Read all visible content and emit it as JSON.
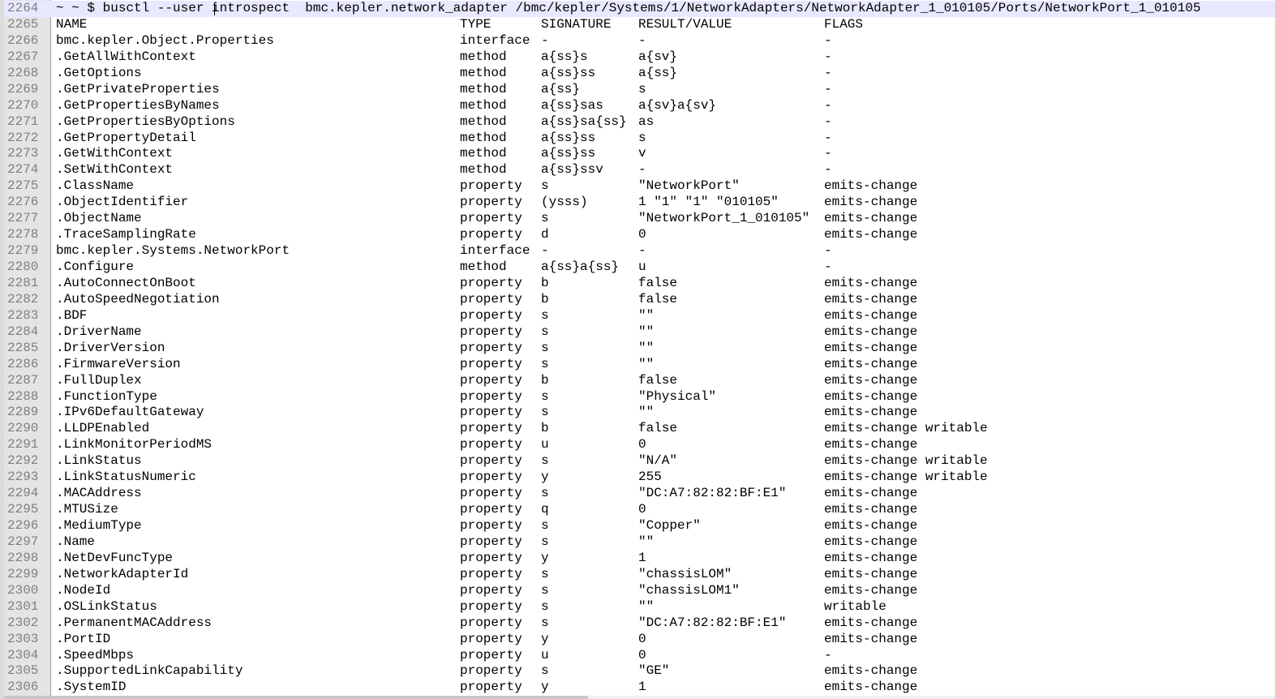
{
  "command": {
    "line_number": "2264",
    "text": "~ ~ $ busctl --user introspect  bmc.kepler.network_adapter /bmc/kepler/Systems/1/NetworkAdapters/NetworkAdapter_1_010105/Ports/NetworkPort_1_010105"
  },
  "header": {
    "line_number": "2265",
    "name": "NAME",
    "type": "TYPE",
    "signature": "SIGNATURE",
    "value": "RESULT/VALUE",
    "flags": "FLAGS"
  },
  "rows": [
    {
      "ln": "2266",
      "name": "bmc.kepler.Object.Properties",
      "type": "interface",
      "sig": "-",
      "val": "-",
      "flags": "-"
    },
    {
      "ln": "2267",
      "name": ".GetAllWithContext",
      "type": "method",
      "sig": "a{ss}s",
      "val": "a{sv}",
      "flags": "-"
    },
    {
      "ln": "2268",
      "name": ".GetOptions",
      "type": "method",
      "sig": "a{ss}ss",
      "val": "a{ss}",
      "flags": "-"
    },
    {
      "ln": "2269",
      "name": ".GetPrivateProperties",
      "type": "method",
      "sig": "a{ss}",
      "val": "s",
      "flags": "-"
    },
    {
      "ln": "2270",
      "name": ".GetPropertiesByNames",
      "type": "method",
      "sig": "a{ss}sas",
      "val": "a{sv}a{sv}",
      "flags": "-"
    },
    {
      "ln": "2271",
      "name": ".GetPropertiesByOptions",
      "type": "method",
      "sig": "a{ss}sa{ss}",
      "val": "as",
      "flags": "-"
    },
    {
      "ln": "2272",
      "name": ".GetPropertyDetail",
      "type": "method",
      "sig": "a{ss}ss",
      "val": "s",
      "flags": "-"
    },
    {
      "ln": "2273",
      "name": ".GetWithContext",
      "type": "method",
      "sig": "a{ss}ss",
      "val": "v",
      "flags": "-"
    },
    {
      "ln": "2274",
      "name": ".SetWithContext",
      "type": "method",
      "sig": "a{ss}ssv",
      "val": "-",
      "flags": "-"
    },
    {
      "ln": "2275",
      "name": ".ClassName",
      "type": "property",
      "sig": "s",
      "val": "\"NetworkPort\"",
      "flags": "emits-change"
    },
    {
      "ln": "2276",
      "name": ".ObjectIdentifier",
      "type": "property",
      "sig": "(ysss)",
      "val": "1 \"1\" \"1\" \"010105\"",
      "flags": "emits-change"
    },
    {
      "ln": "2277",
      "name": ".ObjectName",
      "type": "property",
      "sig": "s",
      "val": "\"NetworkPort_1_010105\"",
      "flags": "emits-change"
    },
    {
      "ln": "2278",
      "name": ".TraceSamplingRate",
      "type": "property",
      "sig": "d",
      "val": "0",
      "flags": "emits-change"
    },
    {
      "ln": "2279",
      "name": "bmc.kepler.Systems.NetworkPort",
      "type": "interface",
      "sig": "-",
      "val": "-",
      "flags": "-"
    },
    {
      "ln": "2280",
      "name": ".Configure",
      "type": "method",
      "sig": "a{ss}a{ss}",
      "val": "u",
      "flags": "-"
    },
    {
      "ln": "2281",
      "name": ".AutoConnectOnBoot",
      "type": "property",
      "sig": "b",
      "val": "false",
      "flags": "emits-change"
    },
    {
      "ln": "2282",
      "name": ".AutoSpeedNegotiation",
      "type": "property",
      "sig": "b",
      "val": "false",
      "flags": "emits-change"
    },
    {
      "ln": "2283",
      "name": ".BDF",
      "type": "property",
      "sig": "s",
      "val": "\"\"",
      "flags": "emits-change"
    },
    {
      "ln": "2284",
      "name": ".DriverName",
      "type": "property",
      "sig": "s",
      "val": "\"\"",
      "flags": "emits-change"
    },
    {
      "ln": "2285",
      "name": ".DriverVersion",
      "type": "property",
      "sig": "s",
      "val": "\"\"",
      "flags": "emits-change"
    },
    {
      "ln": "2286",
      "name": ".FirmwareVersion",
      "type": "property",
      "sig": "s",
      "val": "\"\"",
      "flags": "emits-change"
    },
    {
      "ln": "2287",
      "name": ".FullDuplex",
      "type": "property",
      "sig": "b",
      "val": "false",
      "flags": "emits-change"
    },
    {
      "ln": "2288",
      "name": ".FunctionType",
      "type": "property",
      "sig": "s",
      "val": "\"Physical\"",
      "flags": "emits-change"
    },
    {
      "ln": "2289",
      "name": ".IPv6DefaultGateway",
      "type": "property",
      "sig": "s",
      "val": "\"\"",
      "flags": "emits-change"
    },
    {
      "ln": "2290",
      "name": ".LLDPEnabled",
      "type": "property",
      "sig": "b",
      "val": "false",
      "flags": "emits-change writable"
    },
    {
      "ln": "2291",
      "name": ".LinkMonitorPeriodMS",
      "type": "property",
      "sig": "u",
      "val": "0",
      "flags": "emits-change"
    },
    {
      "ln": "2292",
      "name": ".LinkStatus",
      "type": "property",
      "sig": "s",
      "val": "\"N/A\"",
      "flags": "emits-change writable"
    },
    {
      "ln": "2293",
      "name": ".LinkStatusNumeric",
      "type": "property",
      "sig": "y",
      "val": "255",
      "flags": "emits-change writable"
    },
    {
      "ln": "2294",
      "name": ".MACAddress",
      "type": "property",
      "sig": "s",
      "val": "\"DC:A7:82:82:BF:E1\"",
      "flags": "emits-change"
    },
    {
      "ln": "2295",
      "name": ".MTUSize",
      "type": "property",
      "sig": "q",
      "val": "0",
      "flags": "emits-change"
    },
    {
      "ln": "2296",
      "name": ".MediumType",
      "type": "property",
      "sig": "s",
      "val": "\"Copper\"",
      "flags": "emits-change"
    },
    {
      "ln": "2297",
      "name": ".Name",
      "type": "property",
      "sig": "s",
      "val": "\"\"",
      "flags": "emits-change"
    },
    {
      "ln": "2298",
      "name": ".NetDevFuncType",
      "type": "property",
      "sig": "y",
      "val": "1",
      "flags": "emits-change"
    },
    {
      "ln": "2299",
      "name": ".NetworkAdapterId",
      "type": "property",
      "sig": "s",
      "val": "\"chassisLOM\"",
      "flags": "emits-change"
    },
    {
      "ln": "2300",
      "name": ".NodeId",
      "type": "property",
      "sig": "s",
      "val": "\"chassisLOM1\"",
      "flags": "emits-change"
    },
    {
      "ln": "2301",
      "name": ".OSLinkStatus",
      "type": "property",
      "sig": "s",
      "val": "\"\"",
      "flags": "writable"
    },
    {
      "ln": "2302",
      "name": ".PermanentMACAddress",
      "type": "property",
      "sig": "s",
      "val": "\"DC:A7:82:82:BF:E1\"",
      "flags": "emits-change"
    },
    {
      "ln": "2303",
      "name": ".PortID",
      "type": "property",
      "sig": "y",
      "val": "0",
      "flags": "emits-change"
    },
    {
      "ln": "2304",
      "name": ".SpeedMbps",
      "type": "property",
      "sig": "u",
      "val": "0",
      "flags": "-"
    },
    {
      "ln": "2305",
      "name": ".SupportedLinkCapability",
      "type": "property",
      "sig": "s",
      "val": "\"GE\"",
      "flags": "emits-change"
    },
    {
      "ln": "2306",
      "name": ".SystemID",
      "type": "property",
      "sig": "y",
      "val": "1",
      "flags": "emits-change"
    }
  ]
}
